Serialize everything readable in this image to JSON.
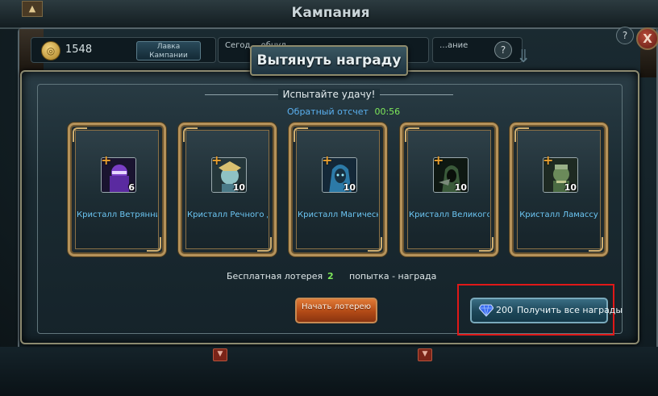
{
  "background": {
    "window_title": "Кампания",
    "coins": "1548",
    "shop_button": "Лавка Кампании",
    "today_text": "Сегод… обнул…",
    "info_text": "…ание",
    "help": "?",
    "close": "X"
  },
  "dialog": {
    "title": "Вытянуть награду",
    "subtitle": "Испытайте удачу!",
    "countdown_label": "Обратный отсчет",
    "countdown_value": "00:56"
  },
  "cards": [
    {
      "name": "Кристалл Ветрянни",
      "count": "6",
      "color": "#7b3fc7",
      "icon": "purple-ninja-portrait-icon"
    },
    {
      "name": "Кристалл Речного д",
      "count": "10",
      "color": "#5fa7b8",
      "icon": "river-spirit-portrait-icon"
    },
    {
      "name": "Кристалл Магическ",
      "count": "10",
      "color": "#2c7aa8",
      "icon": "hooded-mage-portrait-icon"
    },
    {
      "name": "Кристалл Великого",
      "count": "10",
      "color": "#3a5a3a",
      "icon": "dark-warrior-portrait-icon"
    },
    {
      "name": "Кристалл Ламассу",
      "count": "10",
      "color": "#6b8a5a",
      "icon": "lamassu-portrait-icon"
    }
  ],
  "lottery": {
    "prefix": "Бесплатная лотерея",
    "count": "2",
    "suffix": "попытка - награда"
  },
  "buttons": {
    "start": "Начать лотерею",
    "get_all_price": "200",
    "get_all_label": "Получить все награды"
  },
  "colors": {
    "accent_blue": "#5ab0f0",
    "accent_green": "#7ee85a",
    "highlight_red": "#e01818",
    "start_orange": "#e07a36"
  }
}
